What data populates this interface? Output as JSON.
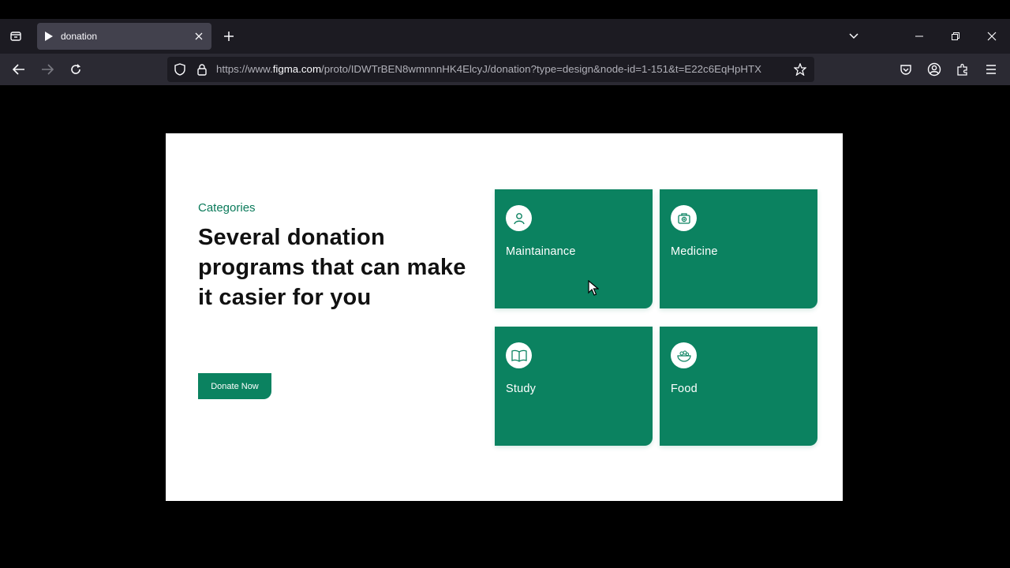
{
  "browser": {
    "tab": {
      "title": "donation"
    },
    "url": {
      "prefix": "https://www.",
      "domain": "figma.com",
      "path": "/proto/IDWTrBEN8wmnnnHK4ElcyJ/donation?type=design&node-id=1-151&t=E22c6EqHpHTX"
    }
  },
  "page": {
    "eyebrow": "Categories",
    "headline": "Several donation programs that can make it casier for you",
    "donate_button": "Donate Now",
    "cards": [
      {
        "label": "Maintainance",
        "icon": "user-icon"
      },
      {
        "label": "Medicine",
        "icon": "medical-kit-icon"
      },
      {
        "label": "Study",
        "icon": "book-icon"
      },
      {
        "label": "Food",
        "icon": "food-bowl-icon"
      }
    ]
  },
  "colors": {
    "accent": "#0b8260",
    "eyebrow": "#0a7a5a",
    "tabbar": "#1c1b22",
    "navbar": "#2b2a33"
  }
}
